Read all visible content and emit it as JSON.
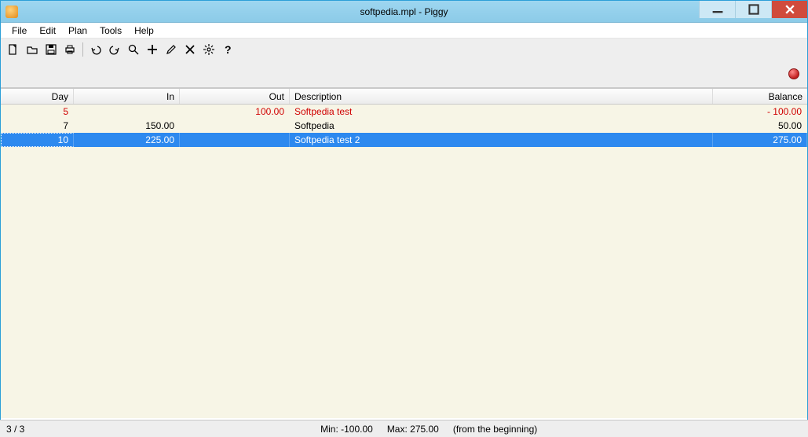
{
  "window": {
    "title": "softpedia.mpl - Piggy"
  },
  "menu": {
    "file": "File",
    "edit": "Edit",
    "plan": "Plan",
    "tools": "Tools",
    "help": "Help"
  },
  "columns": {
    "day": "Day",
    "in": "In",
    "out": "Out",
    "description": "Description",
    "balance": "Balance"
  },
  "rows": [
    {
      "day": "5",
      "in": "",
      "out": "100.00",
      "description": "Softpedia test",
      "balance": "- 100.00",
      "style": "red"
    },
    {
      "day": "7",
      "in": "150.00",
      "out": "",
      "description": "Softpedia",
      "balance": "50.00",
      "style": ""
    },
    {
      "day": "10",
      "in": "225.00",
      "out": "",
      "description": "Softpedia test 2",
      "balance": "275.00",
      "style": "selected"
    }
  ],
  "status": {
    "count": "3 / 3",
    "min": "Min: -100.00",
    "max": "Max: 275.00",
    "note": "(from the beginning)"
  }
}
